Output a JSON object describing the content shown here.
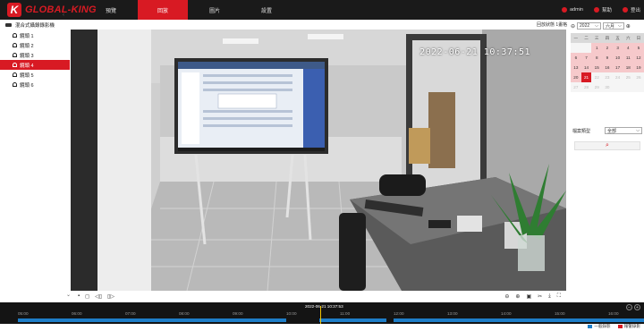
{
  "brand": {
    "mark": "K",
    "name": "GLOBAL-KING"
  },
  "nav": {
    "items": [
      "預覽",
      "回放",
      "圖片",
      "設置"
    ],
    "active": 1
  },
  "topright": {
    "user": "admin",
    "help": "幫助",
    "logout": "登出"
  },
  "sidebar": {
    "title": "混合式攝錄錄影機",
    "channels": [
      "鏡頭 1",
      "鏡頭 2",
      "鏡頭 3",
      "鏡頭 4",
      "鏡頭 5",
      "鏡頭 6"
    ],
    "active": 3
  },
  "video": {
    "osd": "2022-06-21  10:37:51"
  },
  "status": {
    "text": "回放狀態  1畫格"
  },
  "calendar": {
    "year": "2022",
    "month": "六月",
    "weekdays": [
      "一",
      "二",
      "三",
      "四",
      "五",
      "六",
      "日"
    ],
    "rows": [
      [
        "",
        "",
        "1",
        "2",
        "3",
        "4",
        "5"
      ],
      [
        "6",
        "7",
        "8",
        "9",
        "10",
        "11",
        "12"
      ],
      [
        "13",
        "14",
        "15",
        "16",
        "17",
        "18",
        "19"
      ],
      [
        "20",
        "21",
        "22",
        "23",
        "24",
        "25",
        "26"
      ],
      [
        "27",
        "28",
        "29",
        "30",
        "",
        "",
        ""
      ]
    ],
    "selected": "21",
    "recorded": [
      "1",
      "2",
      "3",
      "4",
      "5",
      "6",
      "7",
      "8",
      "9",
      "10",
      "11",
      "12",
      "13",
      "14",
      "15",
      "16",
      "17",
      "18",
      "19",
      "20"
    ]
  },
  "search": {
    "type_label": "檔案類型",
    "type_value": "全部"
  },
  "timeline": {
    "cursor_time": "2022-06-21 10:37:53",
    "hours": [
      "05:00",
      "06:00",
      "07:00",
      "08:00",
      "09:00",
      "10:00",
      "11:00",
      "12:00",
      "13:00",
      "14:00",
      "15:00",
      "16:00"
    ],
    "record_color": "#1e7ec8"
  },
  "legend": {
    "normal": "一般錄影",
    "alarm": "報警錄影",
    "normal_color": "#1e7ec8",
    "alarm_color": "#d81a23"
  }
}
